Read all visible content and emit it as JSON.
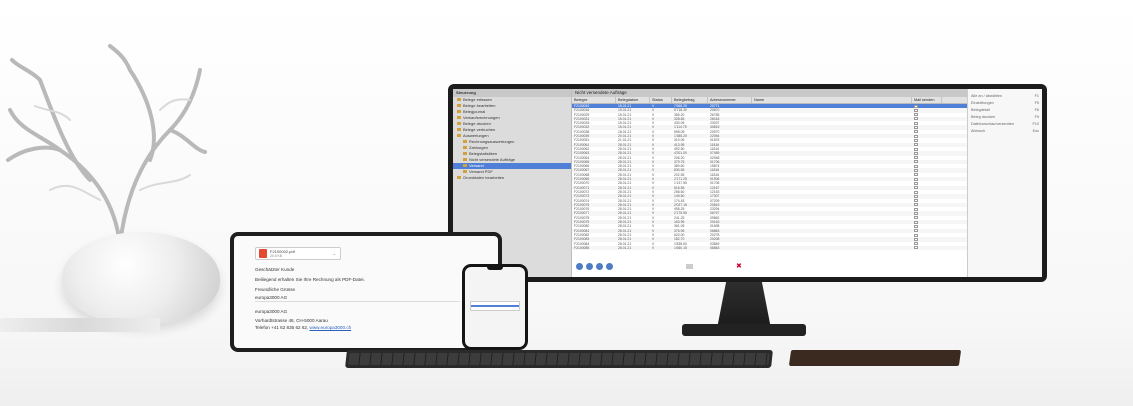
{
  "app": {
    "tree_header": "Steuerung",
    "tree": [
      {
        "label": "Belege erfassen"
      },
      {
        "label": "Belege bearbeiten"
      },
      {
        "label": "Belegjournal"
      },
      {
        "label": "Verkaufsrechnungen"
      },
      {
        "label": "Belege drucken"
      },
      {
        "label": "Belege verbuchen"
      },
      {
        "label": "Auswertungen"
      },
      {
        "label": "Rechnungsauswertungen"
      },
      {
        "label": "Zahlungen"
      },
      {
        "label": "Belegstatistiken"
      },
      {
        "label": "Nicht versendete Aufträge"
      },
      {
        "label": "Versand"
      },
      {
        "label": "Versand PDF"
      },
      {
        "label": "Grunddaten bearbeiten"
      }
    ],
    "selected_tree_index": 11,
    "table_title": "Nicht versendete Aufträge",
    "columns": [
      "Belegnr.",
      "Belegdatum",
      "Status",
      "Belegbetrag",
      "Adressnummer",
      "Name",
      "Mail senden"
    ],
    "rows": [
      [
        "F2100010",
        "18.01.21",
        "V",
        "7'668.25",
        "20771"
      ],
      [
        "F2100016",
        "15.01.21",
        "V",
        "5'718.30",
        "20870"
      ],
      [
        "F2100029",
        "15.01.21",
        "V",
        "355.20",
        "26785"
      ],
      [
        "F2100031",
        "15.01.21",
        "V",
        "328.65",
        "26018"
      ],
      [
        "F2100033",
        "15.01.21",
        "V",
        "430.05",
        "23037"
      ],
      [
        "F2100032",
        "15.01.21",
        "V",
        "1'114.75",
        "40815"
      ],
      [
        "F2100038",
        "18.01.21",
        "V",
        "598.05",
        "20970"
      ],
      [
        "F2100039",
        "20.01.21",
        "V",
        "1'385.20",
        "22054"
      ],
      [
        "F2100051",
        "21.01.21",
        "V",
        "310.05",
        "01876"
      ],
      [
        "F2100061",
        "28.01.21",
        "V",
        "413.95",
        "11816"
      ],
      [
        "F2100062",
        "28.01.21",
        "V",
        "492.50",
        "11816"
      ],
      [
        "F2100063",
        "28.01.21",
        "V",
        "4'201.00",
        "07489"
      ],
      [
        "F2100064",
        "28.01.21",
        "V",
        "206.20",
        "02948"
      ],
      [
        "F2100065",
        "28.01.21",
        "V",
        "379.75",
        "01706"
      ],
      [
        "F2100066",
        "28.01.21",
        "V",
        "380.60",
        "15874"
      ],
      [
        "F2100067",
        "28.01.21",
        "V",
        "830.55",
        "11816"
      ],
      [
        "F2100068",
        "28.01.21",
        "V",
        "202.55",
        "11816"
      ],
      [
        "F2100069",
        "28.01.21",
        "V",
        "2'171.25",
        "01906"
      ],
      [
        "F2100070",
        "28.01.21",
        "V",
        "1'137.55",
        "01706"
      ],
      [
        "F2100071",
        "28.01.21",
        "V",
        "516.55",
        "12167"
      ],
      [
        "F2100072",
        "28.01.21",
        "V",
        "258.60",
        "12153"
      ],
      [
        "F2100073",
        "28.01.21",
        "V",
        "149.50",
        "17307"
      ],
      [
        "F2100074",
        "28.01.21",
        "V",
        "174.45",
        "07209"
      ],
      [
        "F2100075",
        "28.01.21",
        "V",
        "2'027.15",
        "20815"
      ],
      [
        "F2100076",
        "28.01.21",
        "V",
        "495.25",
        "23294"
      ],
      [
        "F2100077",
        "28.01.21",
        "V",
        "2'175.55",
        "06767"
      ],
      [
        "F2100078",
        "28.01.21",
        "V",
        "241.25",
        "09862"
      ],
      [
        "F2100079",
        "28.01.21",
        "V",
        "163.95",
        "20163"
      ],
      [
        "F2100080",
        "28.01.21",
        "V",
        "361.05",
        "01698"
      ],
      [
        "F2100081",
        "28.01.21",
        "V",
        "376.95",
        "06863"
      ],
      [
        "F2100082",
        "28.01.21",
        "V",
        "620.00",
        "20278"
      ],
      [
        "F2100083",
        "28.01.21",
        "V",
        "182.70",
        "20208"
      ],
      [
        "F2100084",
        "28.01.21",
        "V",
        "1'838.60",
        "03849"
      ],
      [
        "F2100085",
        "28.01.21",
        "V",
        "1'660.15",
        "06863"
      ]
    ],
    "menu": [
      {
        "label": "Alle an / abwählen",
        "key": "F1"
      },
      {
        "label": "Einstellungen",
        "key": "F5"
      },
      {
        "label": "Belegdetail",
        "key": "F6"
      },
      {
        "label": "Beleg drucken",
        "key": "F9"
      },
      {
        "label": "Dateivorschau/versenden",
        "key": "F10"
      },
      {
        "label": "Abbruch",
        "key": "Esc"
      }
    ]
  },
  "tablet": {
    "attachment_name": "F2100002.pdf",
    "attachment_size": "20.5 KB",
    "greeting": "Geschätzter Kunde",
    "body": "Beiliegend erhalten Sie Ihre Rechnung als PDF-Datei.",
    "closing": "Freundliche Grüsse",
    "sender": "europa3000 AG",
    "company": "europa3000 AG",
    "address": "Vorhardtstrasse 46, CH-5000 Aarau",
    "phone_prefix": "Telefon +41 62 836 62 62,",
    "website": "www.europa3000.ch"
  },
  "colors": {
    "accent": "#4f7fd6",
    "pdf": "#e24b2f",
    "link": "#2a62b8"
  }
}
